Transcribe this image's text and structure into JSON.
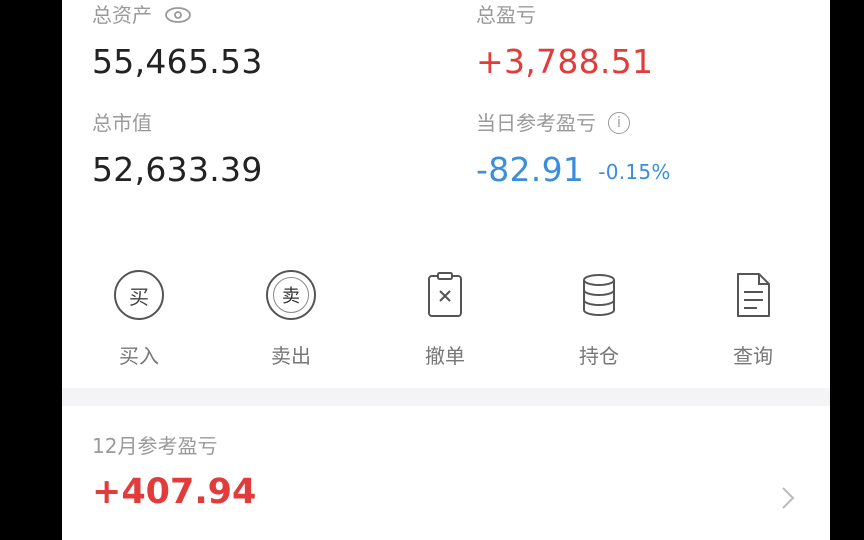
{
  "summary": {
    "total_assets_label": "总资产",
    "total_assets_value": "55,465.53",
    "total_pnl_label": "总盈亏",
    "total_pnl_value": "+3,788.51",
    "market_value_label": "总市值",
    "market_value_value": "52,633.39",
    "daily_pnl_label": "当日参考盈亏",
    "daily_pnl_value": "-82.91",
    "daily_pnl_pct": "-0.15%"
  },
  "actions": {
    "buy_glyph": "买",
    "buy_label": "买入",
    "sell_glyph": "卖",
    "sell_label": "卖出",
    "cancel_label": "撤单",
    "holdings_label": "持仓",
    "query_label": "查询"
  },
  "monthly": {
    "label": "12月参考盈亏",
    "value": "+407.94"
  },
  "icons": {
    "eye": "eye-icon",
    "info": "info-icon",
    "cancel": "cancel-order-icon",
    "holdings": "holdings-icon",
    "query": "document-icon",
    "chevron": "chevron-right-icon"
  },
  "colors": {
    "up": "#e23b3b",
    "down": "#3b8ddd",
    "muted": "#9a9a9a"
  }
}
